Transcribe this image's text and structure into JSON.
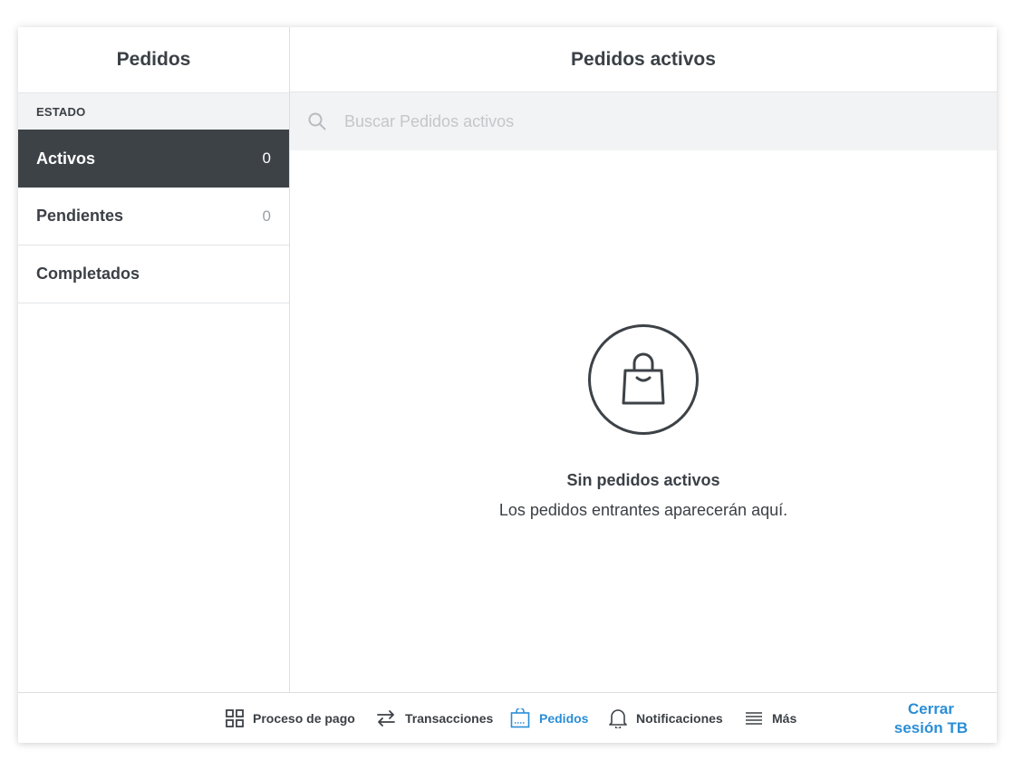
{
  "sidebar": {
    "title": "Pedidos",
    "section_label": "ESTADO",
    "items": [
      {
        "label": "Activos",
        "count": "0"
      },
      {
        "label": "Pendientes",
        "count": "0"
      },
      {
        "label": "Completados",
        "count": ""
      }
    ]
  },
  "main": {
    "title": "Pedidos activos",
    "search": {
      "value": "",
      "placeholder": "Buscar Pedidos activos"
    },
    "empty_state": {
      "icon": "shopping-bag-icon",
      "title": "Sin pedidos activos",
      "subtitle": "Los pedidos entrantes aparecerán aquí."
    }
  },
  "bottom_bar": {
    "tabs": [
      {
        "label": "Proceso de pago",
        "icon": "grid-icon"
      },
      {
        "label": "Transacciones",
        "icon": "transfer-arrows-icon"
      },
      {
        "label": "Pedidos",
        "icon": "orders-bag-icon"
      },
      {
        "label": "Notificaciones",
        "icon": "bell-icon"
      },
      {
        "label": "Más",
        "icon": "menu-lines-icon"
      }
    ],
    "active_tab": "Pedidos",
    "logout_line1": "Cerrar",
    "logout_line2": "sesión TB"
  },
  "colors": {
    "accent": "#2b8ed6",
    "dark": "#3d4247",
    "panel_bg": "#f2f3f4"
  }
}
